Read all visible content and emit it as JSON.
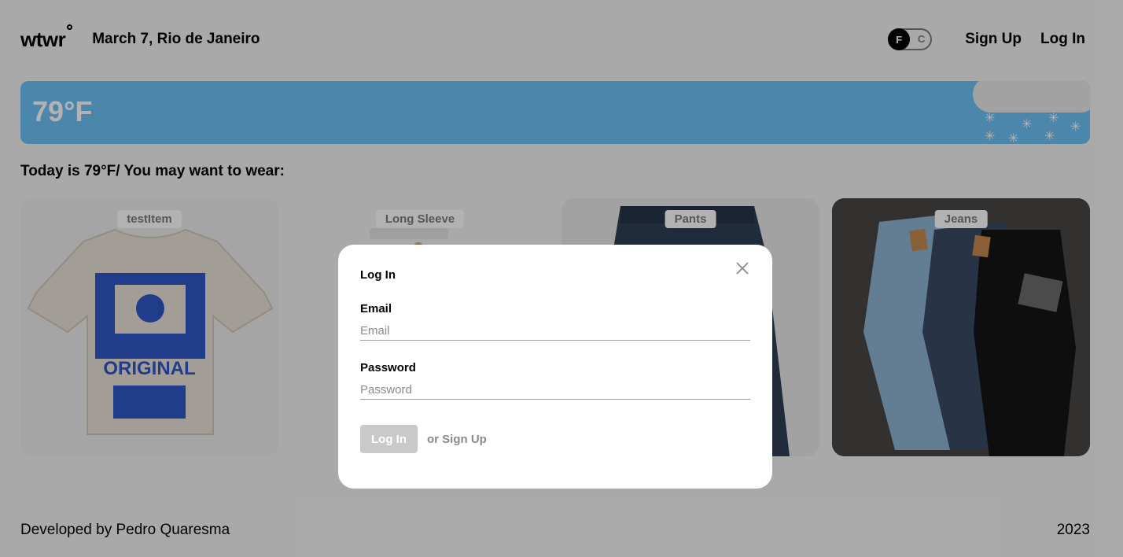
{
  "header": {
    "logo": "wtwr",
    "date_location": "March 7, Rio de Janeiro",
    "toggle": {
      "on": "F",
      "off": "C"
    },
    "signup_label": "Sign Up",
    "login_label": "Log In"
  },
  "weather": {
    "temperature": "79°F",
    "condition_icons": [
      "snowflake-icon",
      "cloud-icon"
    ],
    "background_color": "#6ec1f4"
  },
  "recommendation": "Today is 79°F/ You may want to wear:",
  "items": [
    {
      "name": "testItem"
    },
    {
      "name": "Long Sleeve"
    },
    {
      "name": "Pants"
    },
    {
      "name": "Jeans"
    }
  ],
  "modal": {
    "title": "Log In",
    "email_label": "Email",
    "email_placeholder": "Email",
    "password_label": "Password",
    "password_placeholder": "Password",
    "submit_label": "Log In",
    "alt_link": "or Sign Up"
  },
  "footer": {
    "developer": "Developed by Pedro Quaresma",
    "year": "2023"
  }
}
